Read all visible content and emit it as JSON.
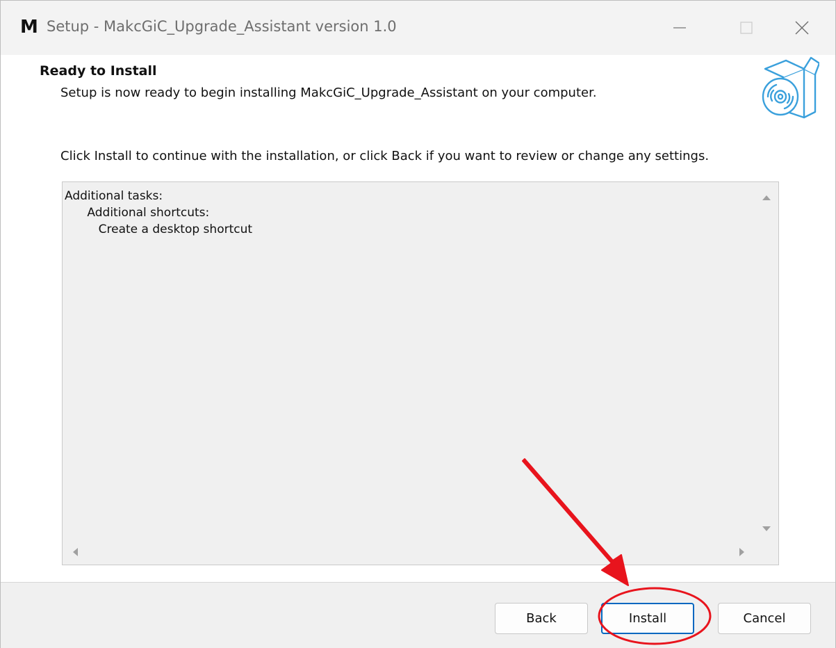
{
  "window": {
    "app_icon_letter": "M",
    "title": "Setup - MakcGiC_Upgrade_Assistant version 1.0"
  },
  "header": {
    "title": "Ready to Install",
    "subtitle": "Setup is now ready to begin installing MakcGiC_Upgrade_Assistant on your computer."
  },
  "body": {
    "instruction": "Click Install to continue with the installation, or click Back if you want to review or change any settings.",
    "memo_lines": [
      "Additional tasks:",
      "      Additional shortcuts:",
      "         Create a desktop shortcut"
    ]
  },
  "buttons": {
    "back": "Back",
    "install": "Install",
    "cancel": "Cancel"
  },
  "icons": {
    "minimize": "minimize-icon",
    "maximize": "maximize-icon",
    "close": "close-icon",
    "header": "software-box-disc-icon"
  },
  "colors": {
    "accent": "#0067c0",
    "annotation": "#e8141d",
    "header_graphic": "#3aa0dc"
  }
}
